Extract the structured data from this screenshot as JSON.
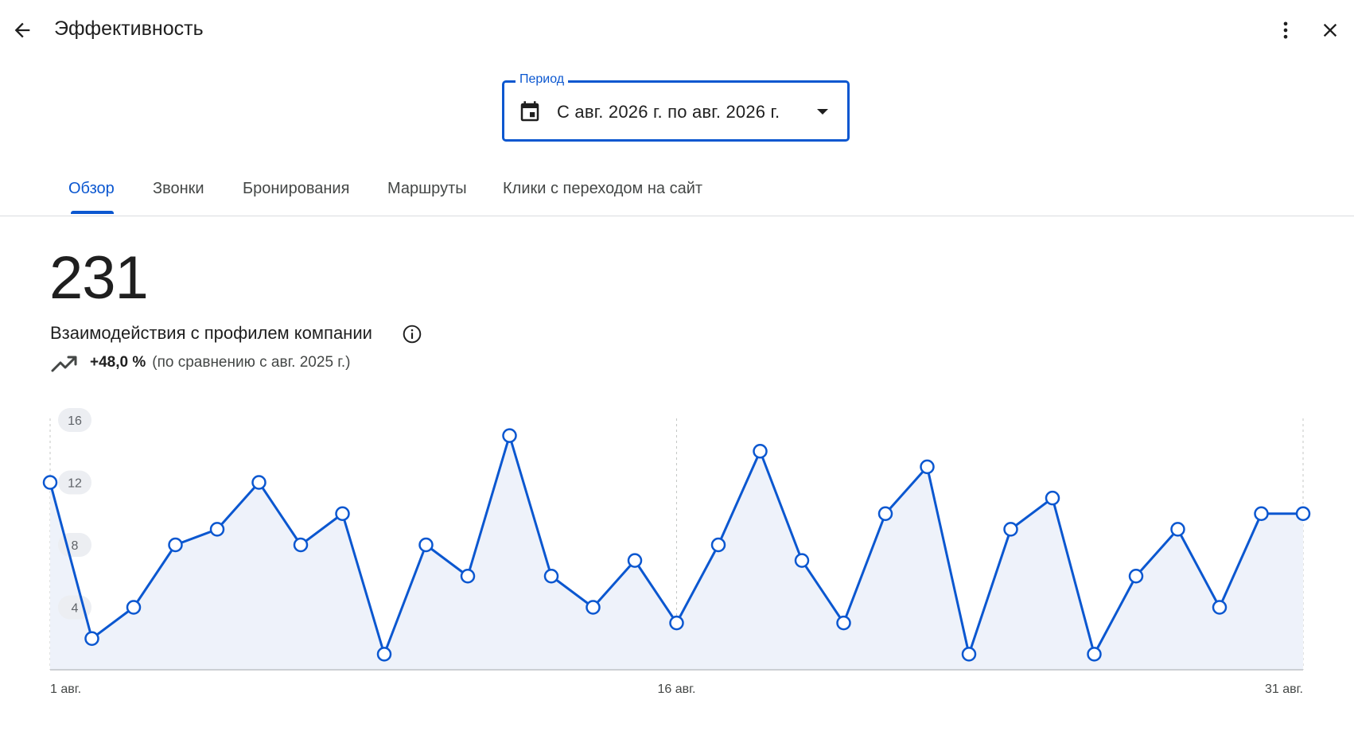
{
  "header": {
    "title": "Эффективность",
    "back_icon": "arrow-left-icon",
    "more_icon": "more-vert-icon",
    "close_icon": "close-icon"
  },
  "period": {
    "label": "Период",
    "value": "С авг. 2026 г. по авг. 2026 г.",
    "icon": "calendar-icon"
  },
  "tabs": [
    {
      "label": "Обзор",
      "active": true
    },
    {
      "label": "Звонки",
      "active": false
    },
    {
      "label": "Бронирования",
      "active": false
    },
    {
      "label": "Маршруты",
      "active": false
    },
    {
      "label": "Клики с переходом на сайт",
      "active": false
    }
  ],
  "summary": {
    "total": "231",
    "metric_label": "Взаимодействия с профилем компании",
    "change_pct": "+48,0 %",
    "change_note": "(по сравнению с авг. 2025 г.)"
  },
  "colors": {
    "accent": "#0b57d0",
    "fill": "#eef2fa"
  },
  "chart_data": {
    "type": "area",
    "x_labels": [
      "1 авг.",
      "16 авг.",
      "31 авг."
    ],
    "x_label_days": [
      1,
      16,
      31
    ],
    "y_ticks": [
      4,
      8,
      12,
      16
    ],
    "ylim": [
      0,
      16
    ],
    "x": [
      1,
      2,
      3,
      4,
      5,
      6,
      7,
      8,
      9,
      10,
      11,
      12,
      13,
      14,
      15,
      16,
      17,
      18,
      19,
      20,
      21,
      22,
      23,
      24,
      25,
      26,
      27,
      28,
      29,
      30,
      31
    ],
    "values": [
      12,
      2,
      4,
      8,
      9,
      12,
      8,
      10,
      1,
      8,
      6,
      15,
      6,
      4,
      7,
      3,
      8,
      14,
      7,
      3,
      10,
      13,
      1,
      9,
      11,
      1,
      6,
      9,
      4,
      10,
      10
    ],
    "grid": "vertical dashed at 1, 16, 31 авг."
  }
}
